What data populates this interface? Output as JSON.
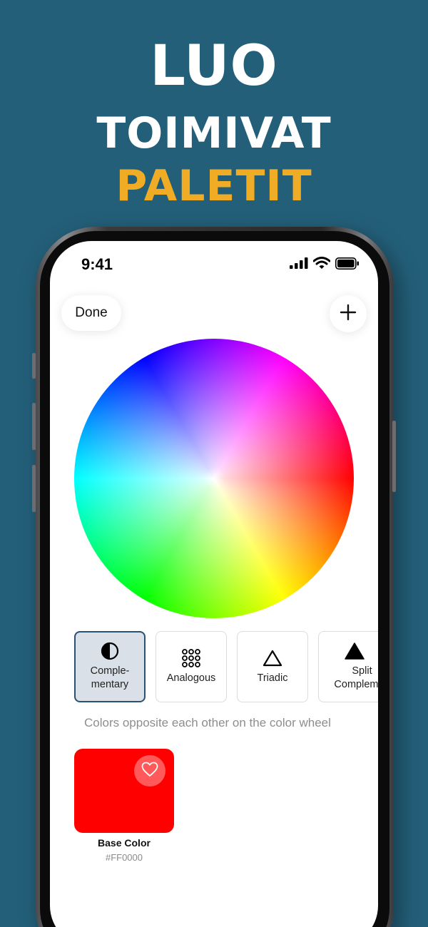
{
  "headline": {
    "line1": "LUO",
    "line2": "TOIMIVAT",
    "line3": "PALETIT",
    "accent_color": "#f0ac24"
  },
  "status_bar": {
    "time": "9:41",
    "icons": [
      "signal-icon",
      "wifi-icon",
      "battery-icon"
    ]
  },
  "toolbar": {
    "done_label": "Done",
    "add_icon": "plus-icon"
  },
  "schemes": [
    {
      "label": "Comple-\nmentary",
      "icon": "half-circle-icon",
      "selected": true
    },
    {
      "label": "Analogous",
      "icon": "dot-grid-icon",
      "selected": false
    },
    {
      "label": "Triadic",
      "icon": "triangle-outline-icon",
      "selected": false
    },
    {
      "label": "Split\nComplemen",
      "icon": "triangle-filled-icon",
      "selected": false
    }
  ],
  "description": "Colors opposite each other on the color wheel",
  "palette": [
    {
      "name": "Base Color",
      "hex": "#FF0000",
      "color": "#ff0000",
      "favorite_icon": "heart-icon"
    }
  ],
  "colors": {
    "background": "#235f79",
    "selected_border": "#2a5173",
    "selected_fill": "#d9e0e7"
  }
}
